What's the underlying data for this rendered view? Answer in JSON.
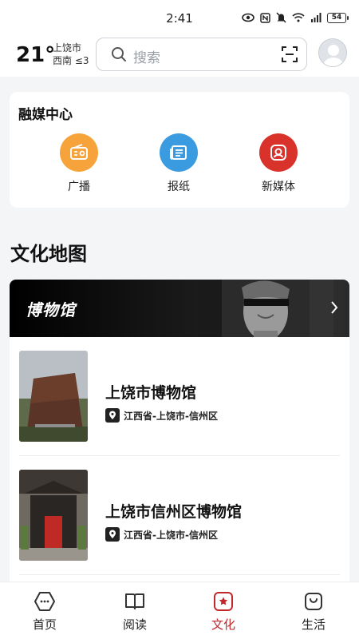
{
  "status_bar": {
    "time": "2:41",
    "battery": "54"
  },
  "header": {
    "temperature": "21°",
    "city": "上饶市",
    "wind": "西南  ≤3",
    "search_placeholder": "搜索"
  },
  "media_center": {
    "title": "融媒中心",
    "items": [
      {
        "label": "广播",
        "icon": "radio-icon",
        "color": "#f6a33b"
      },
      {
        "label": "报纸",
        "icon": "newspaper-icon",
        "color": "#3a9be0"
      },
      {
        "label": "新媒体",
        "icon": "new-media-icon",
        "color": "#d8322b"
      }
    ]
  },
  "culture_map": {
    "title": "文化地图",
    "banner_title": "博物馆",
    "museums": [
      {
        "name": "上饶市博物馆",
        "address": "江西省-上饶市-信州区"
      },
      {
        "name": "上饶市信州区博物馆",
        "address": "江西省-上饶市-信州区"
      }
    ]
  },
  "tab_bar": {
    "active": "文化",
    "accent": "#c0272d",
    "tabs": [
      {
        "label": "首页",
        "icon": "home-icon"
      },
      {
        "label": "阅读",
        "icon": "book-icon"
      },
      {
        "label": "文化",
        "icon": "culture-icon"
      },
      {
        "label": "生活",
        "icon": "life-bag-icon"
      }
    ]
  }
}
